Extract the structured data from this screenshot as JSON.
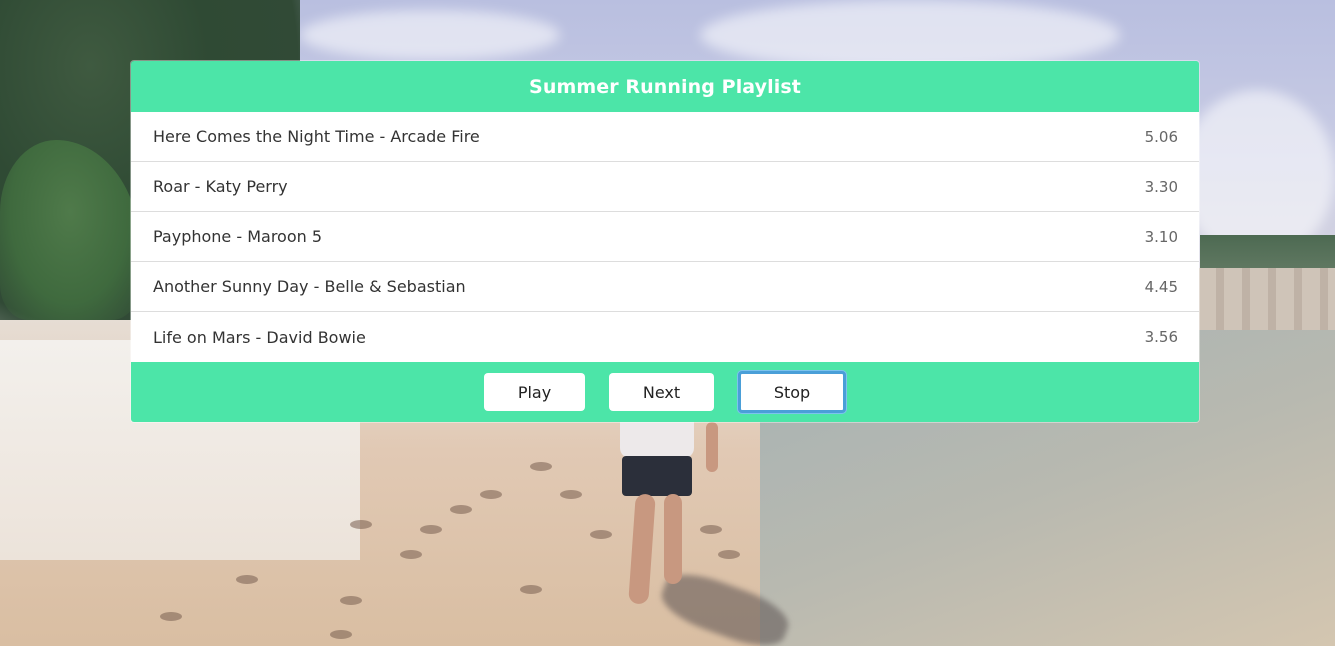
{
  "playlist": {
    "title": "Summer Running Playlist",
    "tracks": [
      {
        "name": "Here Comes the Night Time - Arcade Fire",
        "duration": "5.06"
      },
      {
        "name": "Roar - Katy Perry",
        "duration": "3.30"
      },
      {
        "name": "Payphone - Maroon 5",
        "duration": "3.10"
      },
      {
        "name": "Another Sunny Day - Belle & Sebastian",
        "duration": "4.45"
      },
      {
        "name": "Life on Mars - David Bowie",
        "duration": "3.56"
      }
    ]
  },
  "controls": {
    "play_label": "Play",
    "next_label": "Next",
    "stop_label": "Stop"
  },
  "colors": {
    "accent": "#4ce5a8",
    "focus_ring": "#4a9fd8"
  }
}
